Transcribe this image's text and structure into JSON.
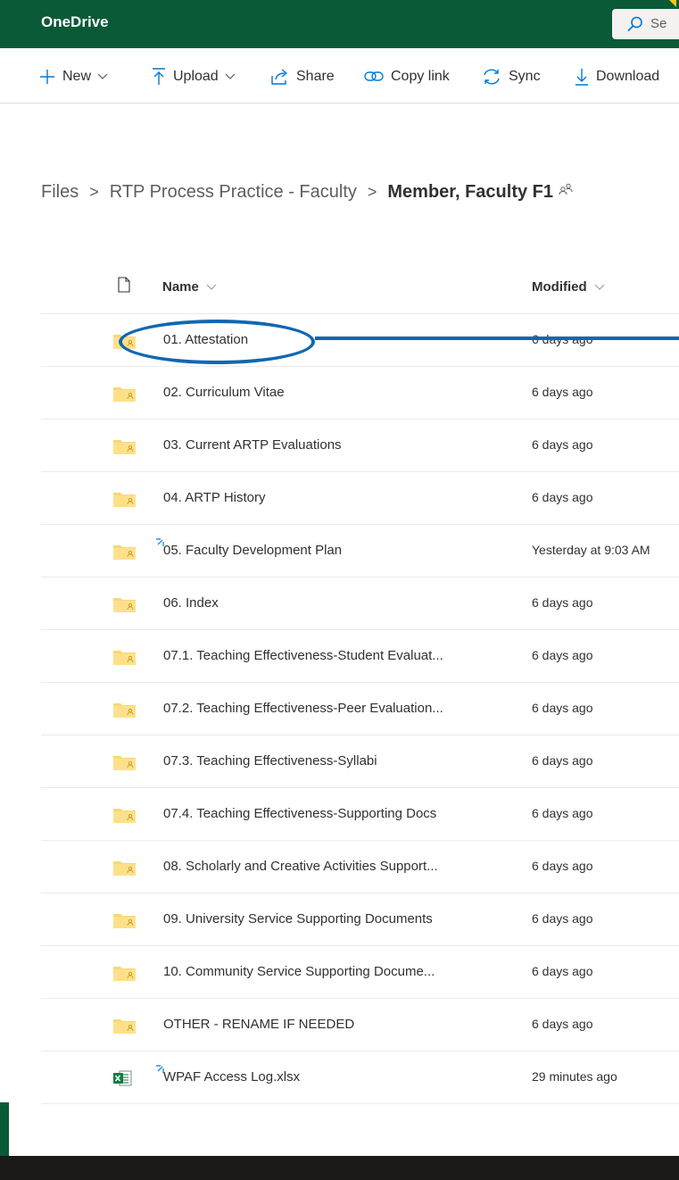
{
  "app": {
    "title": "OneDrive"
  },
  "search": {
    "placeholder": "Se"
  },
  "commands": {
    "new": "New",
    "upload": "Upload",
    "share": "Share",
    "copy_link": "Copy link",
    "sync": "Sync",
    "download": "Download"
  },
  "breadcrumb": {
    "root": "Files",
    "parent": "RTP Process Practice - Faculty",
    "current": "Member, Faculty F1"
  },
  "list": {
    "columns": {
      "name": "Name",
      "modified": "Modified"
    },
    "items": [
      {
        "name": "01. Attestation",
        "modified": "6 days ago",
        "type": "shared-folder"
      },
      {
        "name": "02. Curriculum Vitae",
        "modified": "6 days ago",
        "type": "shared-folder"
      },
      {
        "name": "03. Current ARTP Evaluations",
        "modified": "6 days ago",
        "type": "shared-folder"
      },
      {
        "name": "04. ARTP History",
        "modified": "6 days ago",
        "type": "shared-folder"
      },
      {
        "name": "05. Faculty Development Plan",
        "modified": "Yesterday at 9:03 AM",
        "type": "shared-folder",
        "new": true
      },
      {
        "name": "06. Index",
        "modified": "6 days ago",
        "type": "shared-folder"
      },
      {
        "name": "07.1. Teaching Effectiveness-Student Evaluat...",
        "modified": "6 days ago",
        "type": "shared-folder"
      },
      {
        "name": "07.2. Teaching Effectiveness-Peer Evaluation...",
        "modified": "6 days ago",
        "type": "shared-folder"
      },
      {
        "name": "07.3. Teaching Effectiveness-Syllabi",
        "modified": "6 days ago",
        "type": "shared-folder"
      },
      {
        "name": "07.4. Teaching Effectiveness-Supporting Docs",
        "modified": "6 days ago",
        "type": "shared-folder"
      },
      {
        "name": "08. Scholarly and Creative Activities Support...",
        "modified": "6 days ago",
        "type": "shared-folder"
      },
      {
        "name": "09. University Service Supporting Documents",
        "modified": "6 days ago",
        "type": "shared-folder"
      },
      {
        "name": "10. Community Service Supporting Docume...",
        "modified": "6 days ago",
        "type": "shared-folder"
      },
      {
        "name": "OTHER - RENAME IF NEEDED",
        "modified": "6 days ago",
        "type": "shared-folder"
      },
      {
        "name": "WPAF Access Log.xlsx",
        "modified": "29 minutes ago",
        "type": "excel",
        "new": true
      }
    ]
  },
  "colors": {
    "brand": "#0a5a37",
    "folder": "#f8d775",
    "excel": "#107c41",
    "annotation": "#1167b1"
  }
}
